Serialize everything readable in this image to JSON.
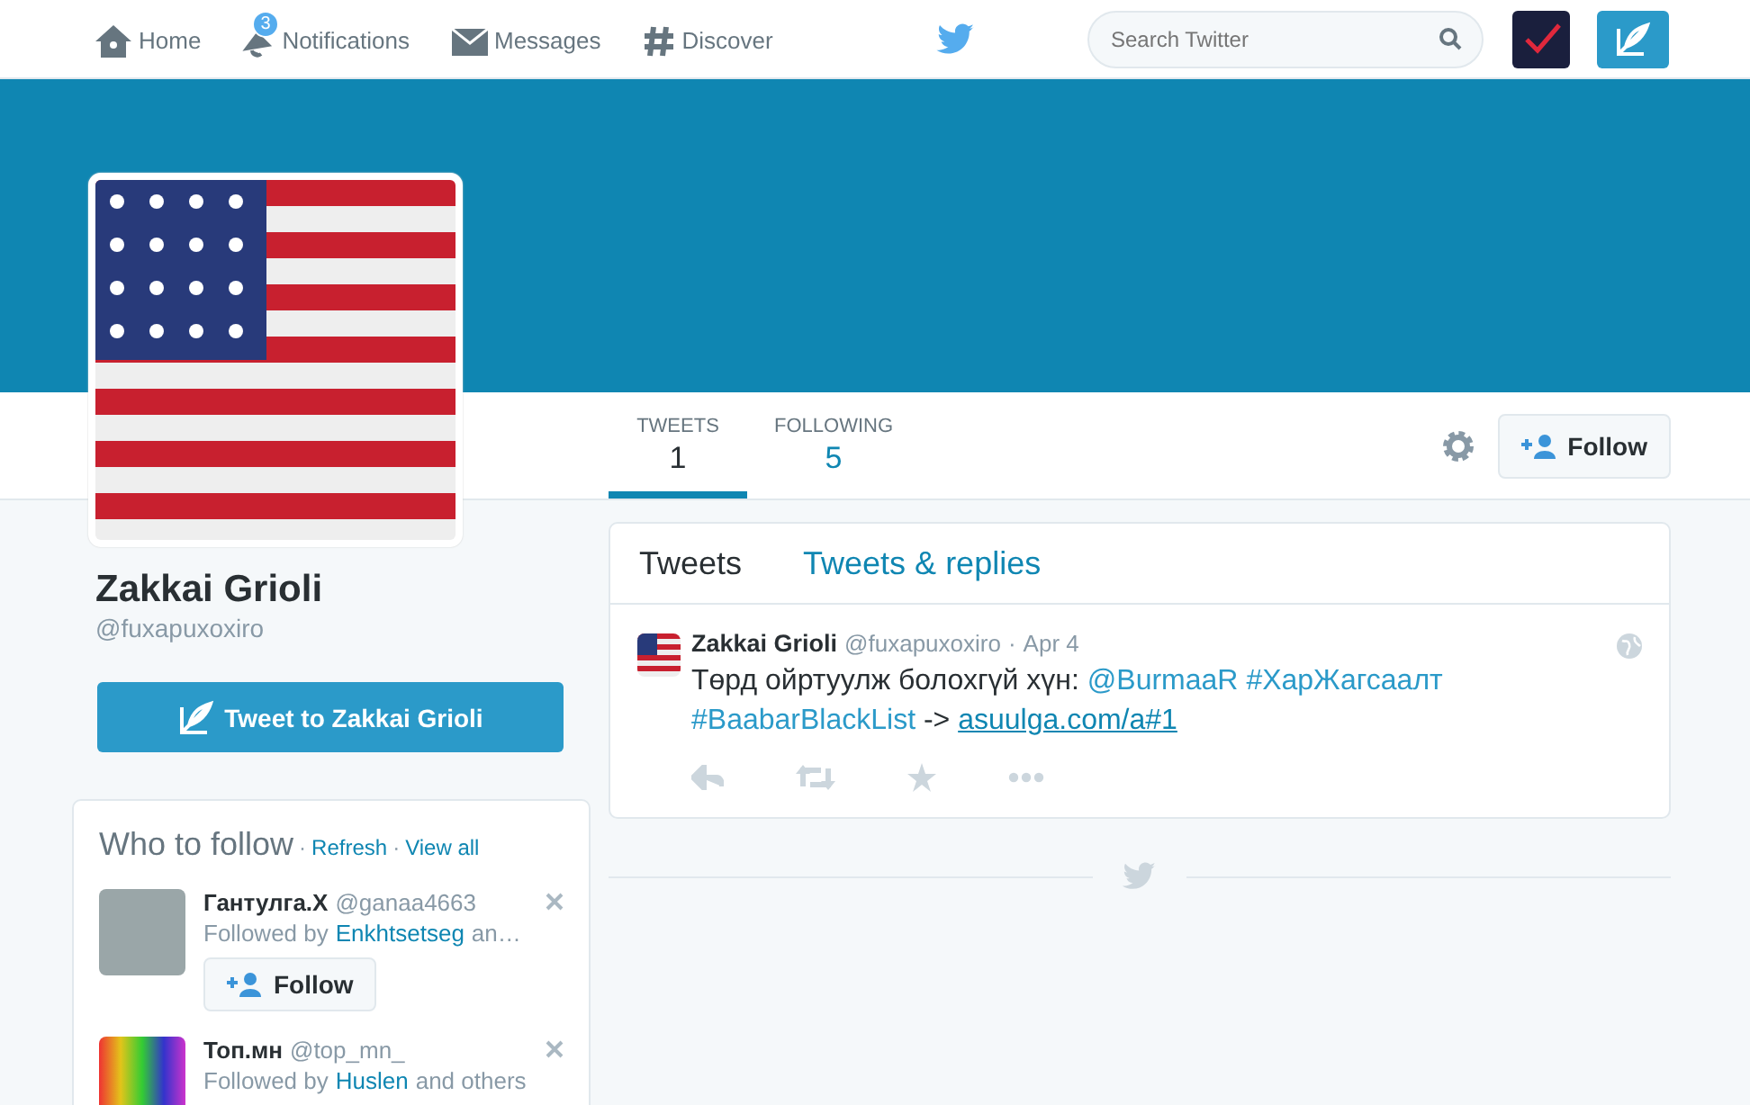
{
  "nav": {
    "items": [
      {
        "label": "Home"
      },
      {
        "label": "Notifications",
        "badge": "3"
      },
      {
        "label": "Messages"
      },
      {
        "label": "Discover"
      }
    ],
    "search": {
      "placeholder": "Search Twitter"
    }
  },
  "profile": {
    "name": "Zakkai Grioli",
    "handle": "@fuxapuxoxiro",
    "tweet_to_button": "Tweet to Zakkai Grioli"
  },
  "stats": [
    {
      "label": "TWEETS",
      "value": "1",
      "selected": true
    },
    {
      "label": "FOLLOWING",
      "value": "5",
      "selected": false
    }
  ],
  "follow_button": "Follow",
  "timeline": {
    "tabs": [
      {
        "label": "Tweets",
        "selected": true
      },
      {
        "label": "Tweets & replies",
        "selected": false
      }
    ],
    "tweets": [
      {
        "name": "Zakkai Grioli",
        "handle": "@fuxapuxoxiro",
        "separator": "·",
        "date": "Apr 4",
        "segments": [
          {
            "kind": "text",
            "text": "Төрд ойртуулж болохгүй хүн: "
          },
          {
            "kind": "mention",
            "text": "@BurmaaR"
          },
          {
            "kind": "hashtag",
            "text": "#ХарЖагсаалт"
          },
          {
            "kind": "hashtag",
            "text": "#BaabarBlackList"
          },
          {
            "kind": "text",
            "text": " -> "
          },
          {
            "kind": "link",
            "text": "asuulga.com/a#1"
          }
        ]
      }
    ]
  },
  "who_to_follow": {
    "title": "Who to follow",
    "links": [
      {
        "separator": "·",
        "label": "Refresh"
      },
      {
        "separator": "·",
        "label": "View all"
      }
    ],
    "users": [
      {
        "name": "Гантулга.Х",
        "handle": "@ganaa4663",
        "followed_by": "Followed by",
        "follower": "Enkhtsetseg",
        "rest": "an…",
        "button": "Follow"
      },
      {
        "name": "Топ.мн",
        "handle": "@top_mn_",
        "followed_by": "Followed by",
        "follower": "Huslen",
        "rest": "and others"
      }
    ]
  }
}
